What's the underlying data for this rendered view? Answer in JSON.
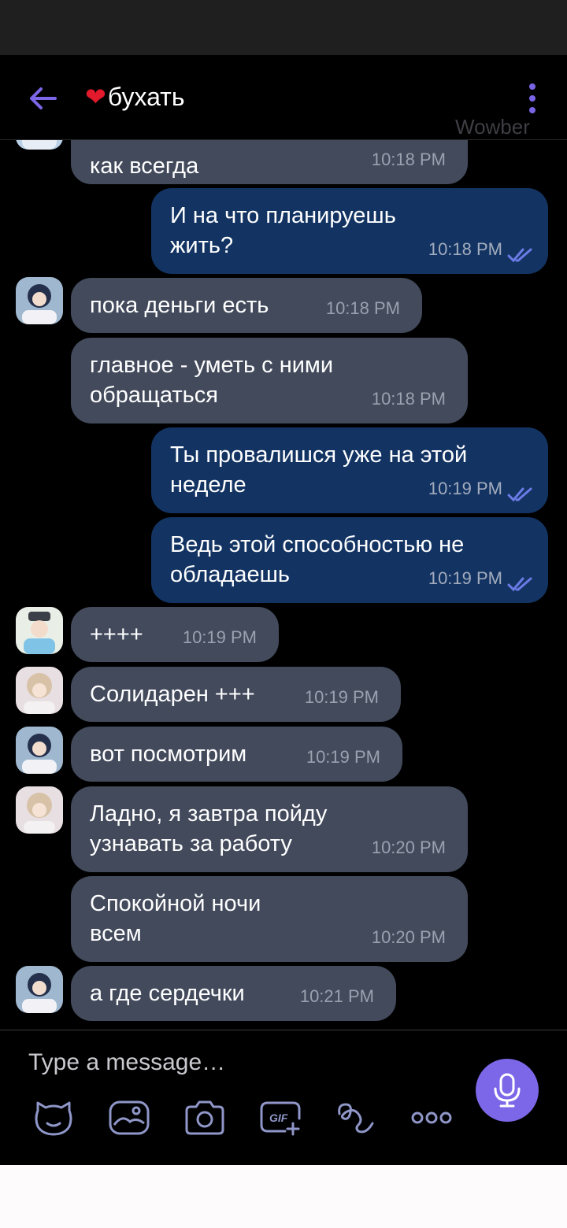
{
  "header": {
    "title_emoji": "❤",
    "title": "бухать",
    "watermark": "Wowber"
  },
  "messages": [
    {
      "text": "как всегда",
      "time": "10:18 PM"
    },
    {
      "text": "И на что планируешь\nжить?",
      "time": "10:18 PM"
    },
    {
      "text": "пока деньги есть",
      "time": "10:18 PM"
    },
    {
      "text": "главное - уметь с ними\nобращаться",
      "time": "10:18 PM"
    },
    {
      "text": "Ты провалишся уже на этой\nнеделе",
      "time": "10:19 PM"
    },
    {
      "text": "Ведь этой способностью не\nобладаешь",
      "time": "10:19 PM"
    },
    {
      "text": "++++",
      "time": "10:19 PM"
    },
    {
      "text": "Солидарен +++",
      "time": "10:19 PM"
    },
    {
      "text": "вот посмотрим",
      "time": "10:19 PM"
    },
    {
      "text": "Ладно, я завтра пойду\nузнавать за работу",
      "time": "10:20 PM"
    },
    {
      "text": "Спокойной ночи\nвсем",
      "time": "10:20 PM"
    },
    {
      "text": "а где сердечки",
      "time": "10:21 PM"
    }
  ],
  "composer": {
    "placeholder": "Type a message…"
  },
  "icons": {
    "back": "back-arrow-icon",
    "menu": "kebab-menu-icon",
    "read": "double-check-icon",
    "mic": "microphone-icon",
    "sticker": "sticker-icon",
    "gallery": "gallery-icon",
    "camera": "camera-icon",
    "gif": "gif-icon",
    "doodle": "doodle-icon",
    "more": "more-icon"
  },
  "colors": {
    "accent": "#7c67e8",
    "incoming_bubble": "#424a5c",
    "outgoing_bubble": "#133463",
    "background": "#000000"
  }
}
